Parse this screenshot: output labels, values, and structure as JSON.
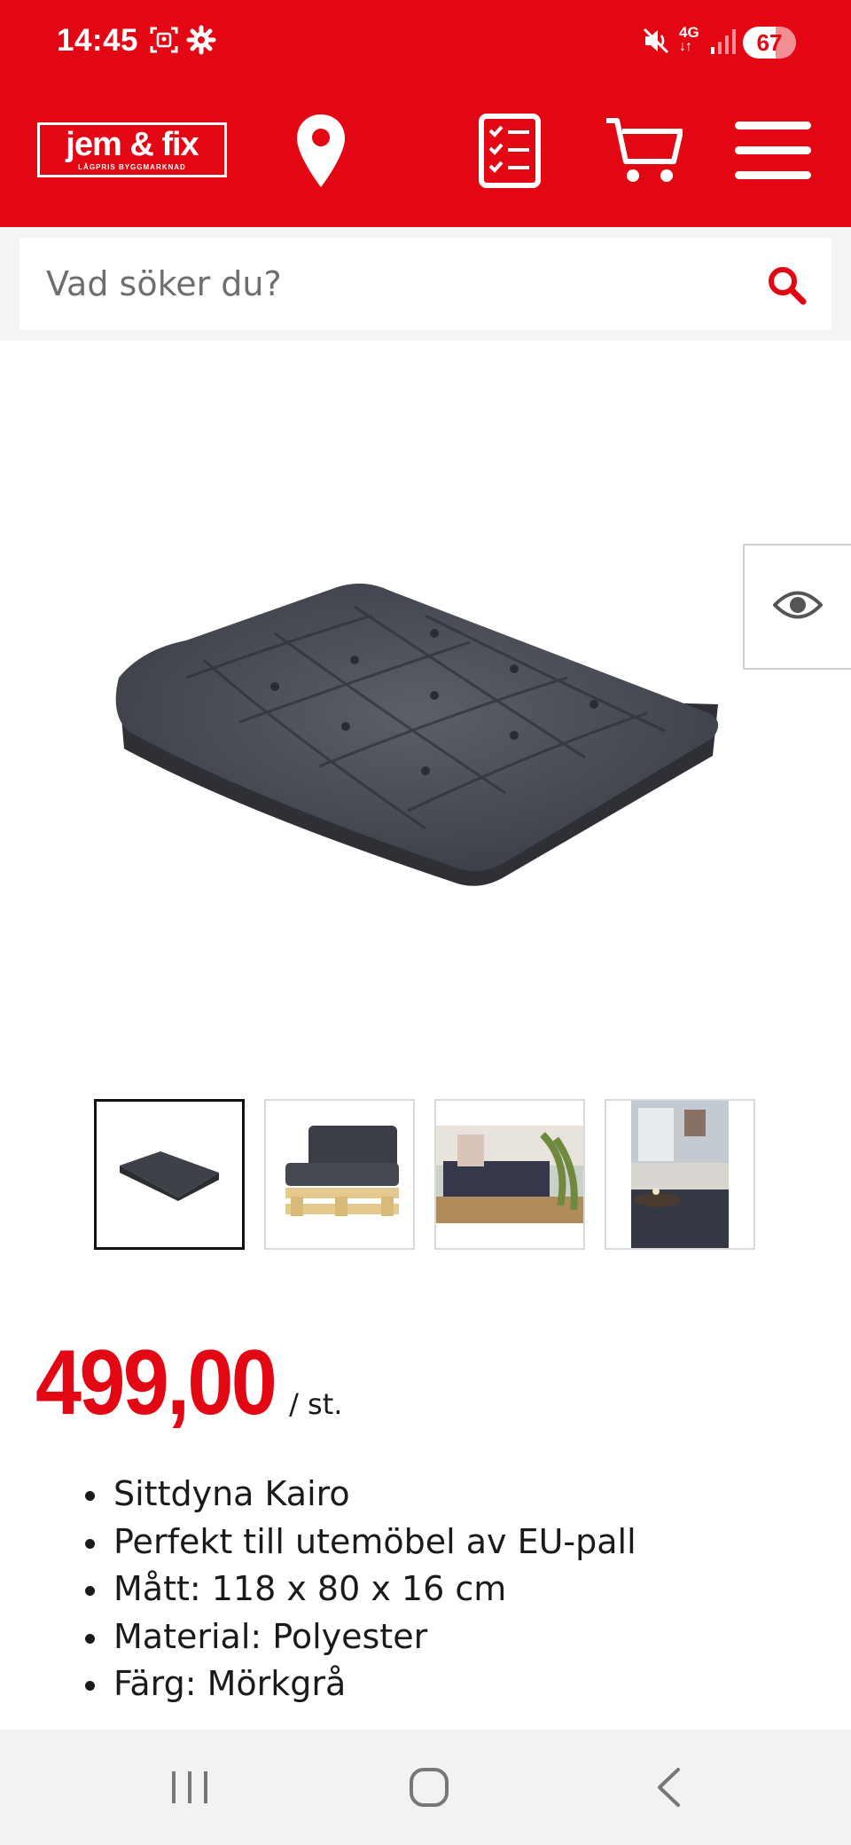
{
  "status_bar": {
    "time": "14:45",
    "network": "4G",
    "battery": "67"
  },
  "header": {
    "logo_text": "jem & fix",
    "logo_subtitle": "LÅGPRIS BYGGMARKNAD",
    "brand_color": "#e30613",
    "icons": [
      "location-pin-icon",
      "shopping-list-icon",
      "cart-icon",
      "hamburger-menu-icon"
    ]
  },
  "search": {
    "placeholder": "Vad söker du?",
    "icon": "search-icon"
  },
  "product": {
    "price": "499,00",
    "unit": "/ st.",
    "features": [
      "Sittdyna Kairo",
      "Perfekt till utemöbel av EU-pall",
      "Mått: 118 x 80 x 16 cm",
      "Material: Polyester",
      "Färg: Mörkgrå"
    ],
    "thumbnails": [
      "cushion",
      "pallet-sofa",
      "outdoor-sofa",
      "indoor-sofa"
    ],
    "active_thumbnail": 0
  },
  "nav": {
    "icons": [
      "recent-apps-icon",
      "home-icon",
      "back-icon"
    ]
  }
}
